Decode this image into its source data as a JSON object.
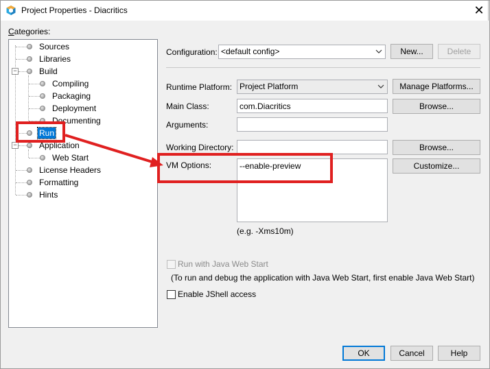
{
  "window": {
    "title": "Project Properties - Diacritics"
  },
  "categories": {
    "label": "Categories:",
    "items": [
      {
        "label": "Sources"
      },
      {
        "label": "Libraries"
      },
      {
        "label": "Build"
      },
      {
        "label": "Compiling"
      },
      {
        "label": "Packaging"
      },
      {
        "label": "Deployment"
      },
      {
        "label": "Documenting"
      },
      {
        "label": "Run"
      },
      {
        "label": "Application"
      },
      {
        "label": "Web Start"
      },
      {
        "label": "License Headers"
      },
      {
        "label": "Formatting"
      },
      {
        "label": "Hints"
      }
    ],
    "selected": "Run",
    "collapse_symbol": "−"
  },
  "config": {
    "label": "Configuration:",
    "value": "<default config>",
    "new_label": "New...",
    "delete_label": "Delete"
  },
  "form": {
    "runtime_platform_label": "Runtime Platform:",
    "runtime_platform_value": "Project Platform",
    "manage_platforms_label": "Manage Platforms...",
    "main_class_label": "Main Class:",
    "main_class_value": "com.Diacritics",
    "browse_main_label": "Browse...",
    "arguments_label": "Arguments:",
    "arguments_value": "",
    "working_dir_label": "Working Directory:",
    "working_dir_value": "",
    "browse_wd_label": "Browse...",
    "vm_options_label": "VM Options:",
    "vm_options_value": "--enable-preview",
    "customize_label": "Customize...",
    "vm_hint": "(e.g. -Xms10m)",
    "web_start_label": "Run with Java Web Start",
    "web_start_note": "(To run and debug the application with Java Web Start, first enable Java Web Start)",
    "jshell_label": "Enable JShell access"
  },
  "buttons": {
    "ok": "OK",
    "cancel": "Cancel",
    "help": "Help"
  },
  "icons": {
    "close": "✕"
  },
  "colors": {
    "selection": "#0078d7",
    "annotation": "#e02020",
    "accent": "#0078d7"
  }
}
